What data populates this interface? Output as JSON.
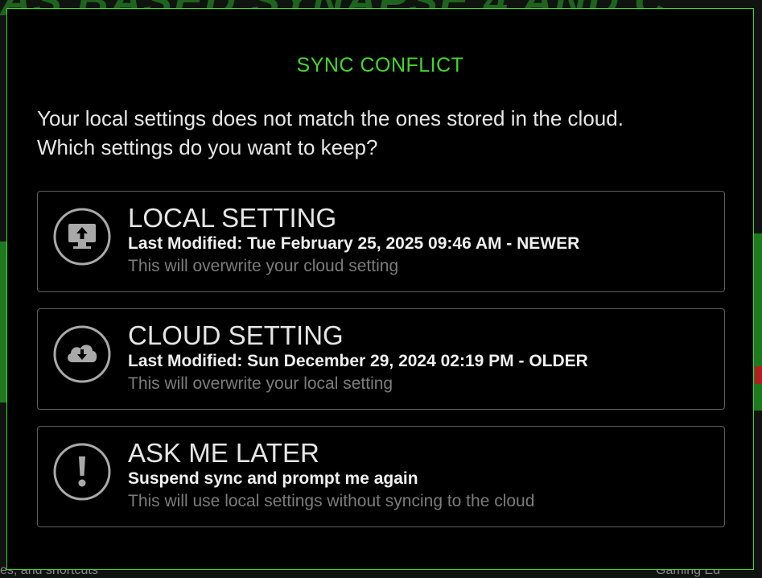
{
  "background": {
    "banner_text": "AS BASED SYNAPSE 4 AND C",
    "footer_left": "es, and shortcuts",
    "footer_right": "Gaming Ed"
  },
  "dialog": {
    "title": "SYNC CONFLICT",
    "message_line1": "Your local settings does not match the ones stored in the cloud.",
    "message_line2": "Which settings do you want to keep?",
    "accent_color": "#44d62c"
  },
  "options": {
    "local": {
      "icon": "monitor-upload-icon",
      "title": "LOCAL SETTING",
      "subtitle": "Last Modified: Tue February 25, 2025 09:46 AM - NEWER",
      "note": "This will overwrite your cloud setting"
    },
    "cloud": {
      "icon": "cloud-download-icon",
      "title": "CLOUD SETTING",
      "subtitle": "Last Modified: Sun December 29, 2024 02:19 PM - OLDER",
      "note": "This will overwrite your local setting"
    },
    "later": {
      "icon": "exclamation-icon",
      "title": "ASK ME LATER",
      "subtitle": "Suspend sync and prompt me again",
      "note": "This will use local settings without syncing to the cloud"
    }
  }
}
